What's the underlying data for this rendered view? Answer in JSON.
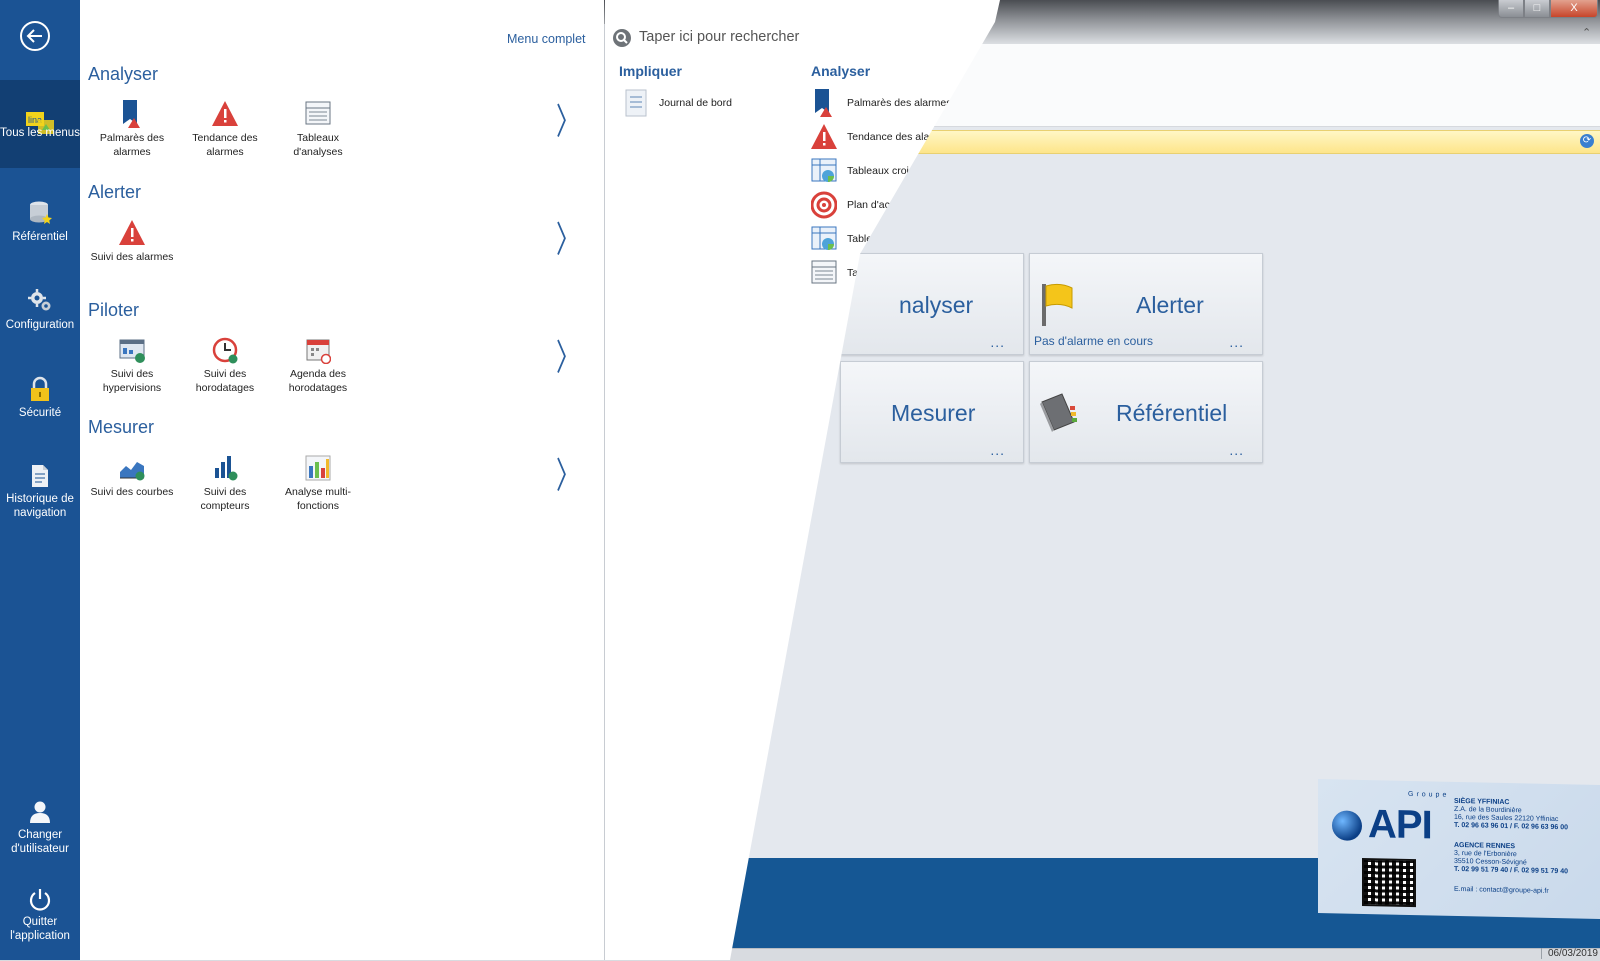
{
  "sidebar": {
    "items": [
      {
        "label": "Tous les menus"
      },
      {
        "label": "Référentiel"
      },
      {
        "label": "Configuration"
      },
      {
        "label": "Sécurité"
      },
      {
        "label": "Historique de navigation"
      },
      {
        "label": "Changer d'utilisateur"
      },
      {
        "label": "Quitter l'application"
      }
    ],
    "badge": "lina"
  },
  "menu": {
    "complete_link": "Menu complet",
    "sections": [
      {
        "title": "Analyser",
        "items": [
          "Palmarès des alarmes",
          "Tendance des alarmes",
          "Tableaux d'analyses"
        ]
      },
      {
        "title": "Alerter",
        "items": [
          "Suivi des alarmes"
        ]
      },
      {
        "title": "Piloter",
        "items": [
          "Suivi des hypervisions",
          "Suivi des horodatages",
          "Agenda des horodatages"
        ]
      },
      {
        "title": "Mesurer",
        "items": [
          "Suivi des courbes",
          "Suivi des compteurs",
          "Analyse multi-fonctions"
        ]
      }
    ],
    "chevron": "〉"
  },
  "search": {
    "placeholder": "Taper ici pour rechercher",
    "columns": [
      {
        "title": "Impliquer",
        "items": [
          "Journal de bord"
        ]
      },
      {
        "title": "Analyser",
        "items": [
          "Palmarès des alarmes",
          "Tendance des alarme",
          "Tableaux croisés dy",
          "Plan d'actions",
          "Tableaux croisé",
          "Tableaux d'ar"
        ]
      }
    ]
  },
  "background": {
    "tiles": [
      {
        "title": "nalyser",
        "dots": "..."
      },
      {
        "title": "Alerter",
        "subtitle": "Pas d'alarme en cours",
        "dots": "..."
      },
      {
        "title": "Mesurer",
        "dots": "..."
      },
      {
        "title": "Référentiel",
        "dots": "..."
      }
    ],
    "status_date": "06/03/2019",
    "window_buttons": {
      "minimize": "–",
      "maximize": "□",
      "close": "X"
    }
  },
  "api_card": {
    "groupe": "Groupe",
    "logo": "API",
    "siege_title": "SIÈGE YFFINIAC",
    "siege_lines": [
      "Z.A. de la Bourdinière",
      "16, rue des Saules 22120 Yffiniac",
      "T. 02 96 63 96 01 / F. 02 96 63 96 00"
    ],
    "agence_title": "AGENCE RENNES",
    "agence_lines": [
      "3, rue de l'Erbonière",
      "35510 Cesson-Sévigné",
      "T. 02 99 51 79 40 / F. 02 99 51 79 40"
    ],
    "email": "E.mail : contact@groupe-api.fr"
  },
  "colors": {
    "sidebar": "#1b5394",
    "accent": "#2b5f9e",
    "alarm_red": "#d9413b",
    "info_bar": "#fde58a"
  }
}
